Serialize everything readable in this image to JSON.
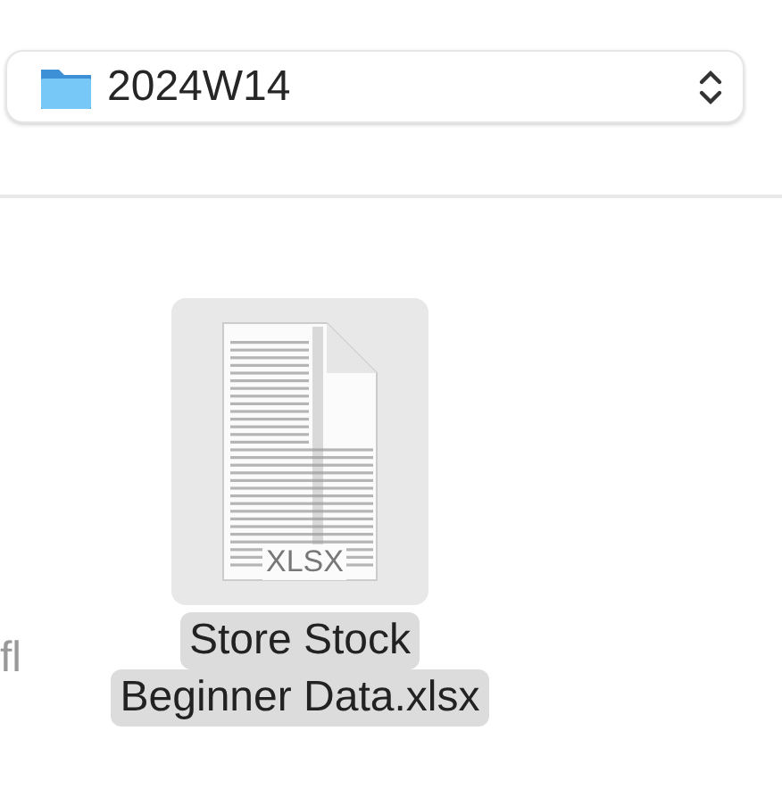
{
  "location_popup": {
    "folder": "2024W14"
  },
  "files": [
    {
      "name_lines": [
        "fl"
      ],
      "kind": "partial"
    },
    {
      "name_lines": [
        "Store Stock",
        "Beginner Data.xlsx"
      ],
      "kind": "spreadsheet",
      "badge": "XLSX",
      "selected": true
    }
  ]
}
